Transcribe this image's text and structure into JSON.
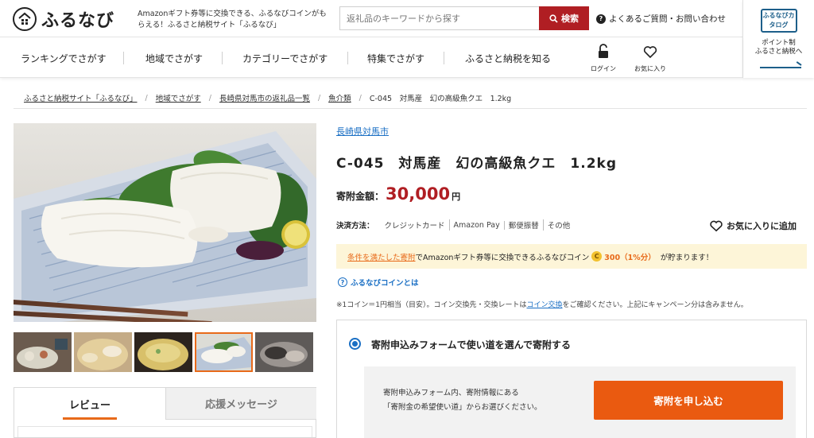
{
  "header": {
    "logo_text": "ふるなび",
    "tagline": "Amazonギフト券等に交換できる、ふるなびコインがもらえる！ふるさと納税サイト「ふるなび」",
    "search_placeholder": "返礼品のキーワードから探す",
    "search_button": "検索",
    "faq_label": "よくあるご質問・お問い合わせ",
    "catalog_book_text": "ふるなびカタログ",
    "catalog_text_line1": "ポイント制",
    "catalog_text_line2": "ふるさと納税へ"
  },
  "nav": {
    "items": [
      "ランキングでさがす",
      "地域でさがす",
      "カテゴリーでさがす",
      "特集でさがす",
      "ふるさと納税を知る"
    ],
    "login_label": "ログイン",
    "favorites_label": "お気に入り"
  },
  "breadcrumb": [
    "ふるさと納税サイト「ふるなび」",
    "地域でさがす",
    "長崎県対馬市の返礼品一覧",
    "魚介類",
    "C-045　対馬産　幻の高級魚クエ　1.2kg"
  ],
  "product": {
    "city": "長崎県対馬市",
    "title": "C-045　対馬産　幻の高級魚クエ　1.2kg",
    "amount_label": "寄附金額：",
    "amount_value": "30,000",
    "amount_unit": "円",
    "payment_label": "決済方法：",
    "payment_methods": [
      "クレジットカード",
      "Amazon Pay",
      "郵便振替",
      "その他"
    ],
    "favorite_button": "お気に入りに追加"
  },
  "coin": {
    "condition_link": "条件を満たした寄附",
    "text_middle": "でAmazonギフト券等に交換できるふるなびコイン",
    "coin_symbol": "C",
    "amount": "300（1%分）",
    "text_end": "が貯まります！",
    "help_link": "ふるなびコインとは",
    "note_before": "※1コイン＝1円相当（目安）。コイン交換先・交換レートは",
    "note_link": "コイン交換",
    "note_after": "をご確認ください。上記にキャンペーン分は含みません。"
  },
  "form": {
    "option_label": "寄附申込みフォームで使い道を選んで寄附する",
    "inner_line1": "寄附申込みフォーム内、寄附情報にある",
    "inner_line2": "「寄附金の希望使い道」からお選びください。",
    "apply_button": "寄附を申し込む"
  },
  "tabs": [
    "レビュー",
    "応援メッセージ"
  ],
  "colors": {
    "brand_red": "#b01e23",
    "accent_orange": "#ea5a10",
    "link_blue": "#1a6fc4",
    "banner_bg": "#fdf5d8"
  }
}
